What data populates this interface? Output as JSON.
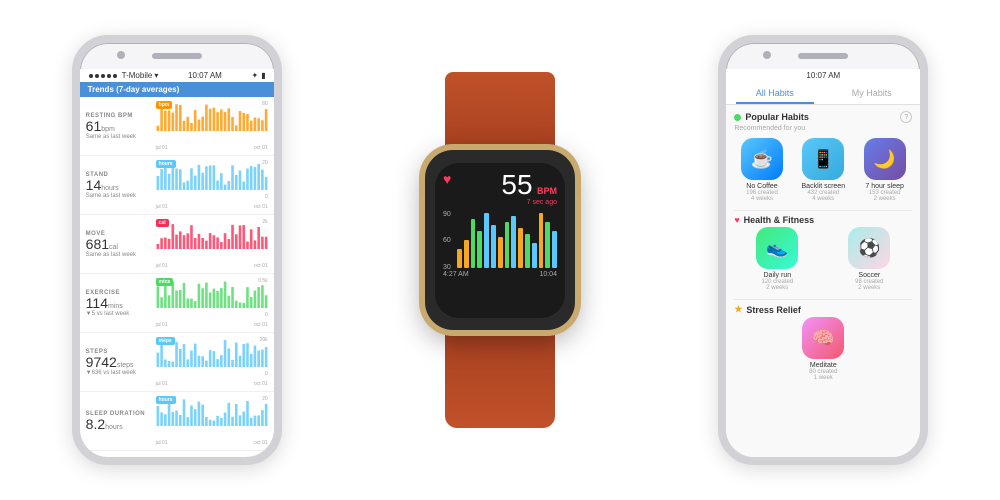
{
  "leftPhone": {
    "status": {
      "carrier": "T-Mobile",
      "time": "10:07 AM",
      "bluetooth": "B",
      "battery": "100%"
    },
    "header": "Trends (7-day averages)",
    "metrics": [
      {
        "name": "RESTING BPM",
        "value": "61",
        "unit": "bpm",
        "sub": "Same as last week",
        "tag": "bpm",
        "tagColor": "#ff9500",
        "yMax": "80",
        "yMid": "60",
        "yMin": "",
        "dateStart": "jul 01",
        "dateEnd": "oct 01",
        "color": "#ff9500"
      },
      {
        "name": "STAND",
        "value": "14",
        "unit": "hours",
        "sub": "Same as last week",
        "tag": "hours",
        "tagColor": "#5ac8fa",
        "yMax": "20",
        "yMid": "10",
        "yMin": "0",
        "dateStart": "jul 01",
        "dateEnd": "oct 01",
        "color": "#5ac8fa"
      },
      {
        "name": "MOVE",
        "value": "681",
        "unit": "cal",
        "sub": "Same as last week",
        "tag": "cal",
        "tagColor": "#ff2d55",
        "yMax": "2k",
        "yMid": "",
        "yMin": "",
        "dateStart": "jul 01",
        "dateEnd": "oct 01",
        "color": "#ff2d55"
      },
      {
        "name": "EXERCISE",
        "value": "114",
        "unit": "mins",
        "sub": "▼5 vs last week",
        "tag": "mins",
        "tagColor": "#4cd964",
        "yMax": "0.5k",
        "yMid": "",
        "yMin": "0",
        "dateStart": "jul 01",
        "dateEnd": "oct 01",
        "color": "#4cd964"
      },
      {
        "name": "STEPS",
        "value": "9742",
        "unit": "steps",
        "sub": "▼636 vs last week",
        "tag": "steps",
        "tagColor": "#5ac8fa",
        "yMax": "20k",
        "yMid": "",
        "yMin": "0",
        "dateStart": "jul 01",
        "dateEnd": "oct 01",
        "color": "#5ac8fa"
      },
      {
        "name": "SLEEP DURATION",
        "value": "8.2",
        "unit": "hours",
        "sub": "",
        "tag": "hours",
        "tagColor": "#5ac8fa",
        "yMax": "20",
        "yMid": "",
        "yMin": "",
        "dateStart": "jul 01",
        "dateEnd": "oct 01",
        "color": "#5ac8fa"
      }
    ]
  },
  "watch": {
    "bpm": "55",
    "bpmUnit": "BPM",
    "ago": "7 sec ago",
    "time": "10:04",
    "timeBottom": "4:27 AM    10:04 AM",
    "bars": [
      30,
      45,
      80,
      60,
      90,
      70,
      50,
      75,
      85,
      65,
      55,
      40,
      90,
      75,
      60
    ]
  },
  "rightPhone": {
    "status": {
      "time": "10:07 AM"
    },
    "tabs": [
      {
        "label": "All Habits",
        "active": true
      },
      {
        "label": "My Habits",
        "active": false
      }
    ],
    "sections": [
      {
        "type": "popular",
        "indicator": "green",
        "title": "Popular Habits",
        "subtitle": "Recommended for you",
        "habits": [
          {
            "name": "No Coffee",
            "count": "196 created",
            "count2": "4 weeks",
            "icon": "☕",
            "iconClass": "icon-coffee"
          },
          {
            "name": "Backlit screen",
            "count": "432 created",
            "count2": "4 weeks",
            "icon": "📱",
            "iconClass": "icon-screen"
          },
          {
            "name": "7 hour sleep",
            "count": "153 created",
            "count2": "2 weeks",
            "icon": "🌙",
            "iconClass": "icon-sleep"
          }
        ]
      },
      {
        "type": "health",
        "indicator": "heart",
        "title": "Health & Fitness",
        "habits": [
          {
            "name": "Daily run",
            "count": "120 created",
            "count2": "2 weeks",
            "icon": "👟",
            "iconClass": "icon-run"
          },
          {
            "name": "Soccer",
            "count": "98 created",
            "count2": "2 weeks",
            "icon": "⚽",
            "iconClass": "icon-soccer"
          }
        ]
      },
      {
        "type": "stress",
        "indicator": "star",
        "title": "Stress Relief",
        "habits": [
          {
            "name": "Meditate",
            "count": "80 created",
            "count2": "1 week",
            "icon": "🧠",
            "iconClass": "icon-stress"
          }
        ]
      }
    ]
  }
}
